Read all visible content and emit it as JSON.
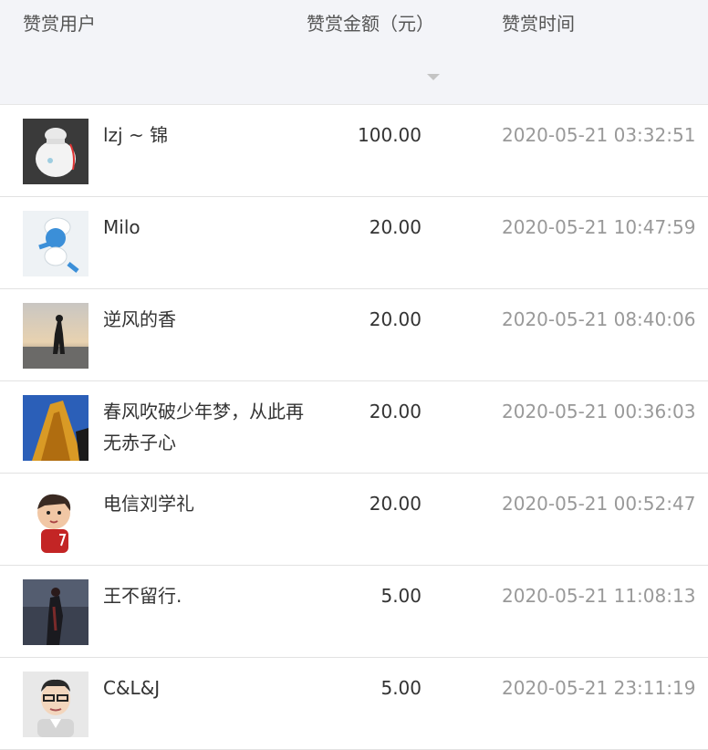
{
  "header": {
    "user_label": "赞赏用户",
    "amount_label": "赞赏金额（元）",
    "time_label": "赞赏时间",
    "sort_icon": "caret-down-icon"
  },
  "rows": [
    {
      "name": "lzj ~ 锦",
      "amount": "100.00",
      "time": "2020-05-21 03:32:51",
      "avatar": "lucky-bag-avatar"
    },
    {
      "name": "Milo",
      "amount": "20.00",
      "time": "2020-05-21 10:47:59",
      "avatar": "smurf-avatar"
    },
    {
      "name": "逆风的香",
      "amount": "20.00",
      "time": "2020-05-21 08:40:06",
      "avatar": "sunset-silhouette-avatar"
    },
    {
      "name": "春风吹破少年梦，从此再无赤子心",
      "amount": "20.00",
      "time": "2020-05-21 00:36:03",
      "avatar": "golden-building-avatar"
    },
    {
      "name": "电信刘学礼",
      "amount": "20.00",
      "time": "2020-05-21 00:52:47",
      "avatar": "cartoon-boy-avatar"
    },
    {
      "name": "王不留行.",
      "amount": "5.00",
      "time": "2020-05-21 11:08:13",
      "avatar": "dark-figure-avatar"
    },
    {
      "name": "C&L&J",
      "amount": "5.00",
      "time": "2020-05-21 23:11:19",
      "avatar": "cartoon-glasses-avatar"
    }
  ]
}
